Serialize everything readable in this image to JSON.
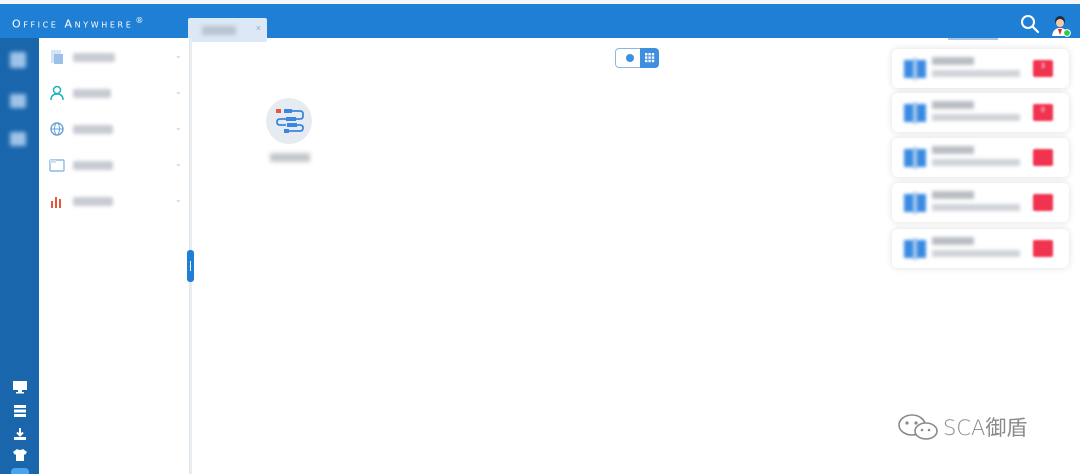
{
  "app": {
    "title": "Office Anywhere",
    "trademark": "®"
  },
  "tabs": [
    {
      "label": "",
      "close": "×"
    }
  ],
  "header": {
    "search_icon": "search-icon",
    "avatar_icon": "user-avatar-icon",
    "online_color": "#2ecc40"
  },
  "activity_bar": {
    "bottom_icons": [
      "monitor-icon",
      "stack-icon",
      "download-icon",
      "shirt-icon"
    ]
  },
  "sidebar": {
    "items": [
      {
        "icon": "document-icon",
        "label": "",
        "chevron": "⌄"
      },
      {
        "icon": "person-icon",
        "label": "",
        "chevron": "⌄"
      },
      {
        "icon": "globe-icon",
        "label": "",
        "chevron": "⌄"
      },
      {
        "icon": "folder-icon",
        "label": "",
        "chevron": "⌄"
      },
      {
        "icon": "bar-chart-icon",
        "label": "",
        "chevron": "⌄"
      }
    ]
  },
  "view_toggle": {
    "icons": [
      "list-view-icon",
      "grid-view-icon"
    ],
    "active": "grid"
  },
  "apps": [
    {
      "icon": "workflow-icon",
      "label": ""
    }
  ],
  "widgets": [
    {
      "title": "",
      "subtitle": "",
      "badge": "3"
    },
    {
      "title": "",
      "subtitle": "",
      "badge": "0"
    },
    {
      "title": "",
      "subtitle": "",
      "badge": ""
    },
    {
      "title": "",
      "subtitle": "",
      "badge": ""
    },
    {
      "title": "",
      "subtitle": "",
      "badge": ""
    }
  ],
  "watermark": {
    "text": "SCA御盾",
    "icon": "wechat-icon"
  },
  "colors": {
    "brand": "#1f7fd4",
    "activity_bar": "#1a66ad",
    "badge": "#f0334f"
  }
}
